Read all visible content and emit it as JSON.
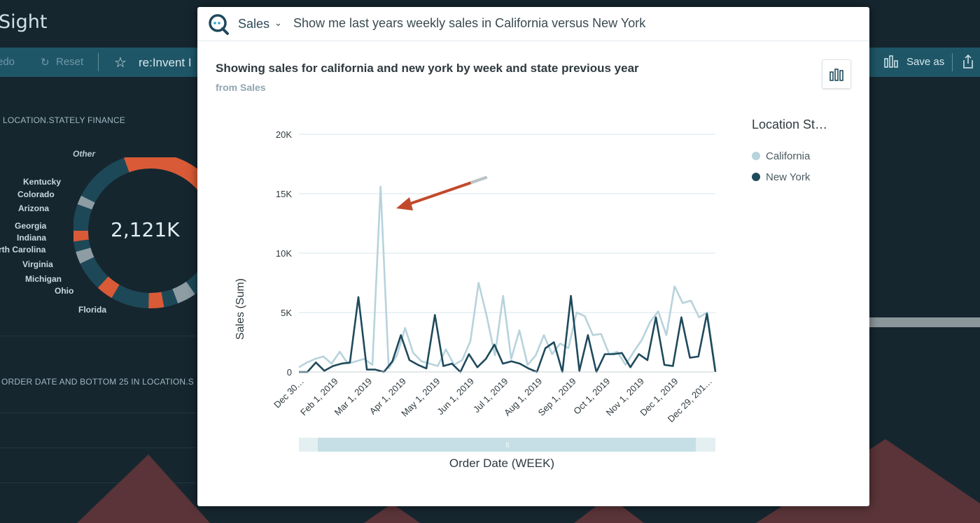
{
  "background": {
    "app_title": "Sight",
    "toolbar": {
      "redo": "edo",
      "reset": "Reset",
      "dashboard_name": "re:Invent I",
      "save_as": "Save as"
    },
    "section1_title": "LOCATION.STATELY FINANCE",
    "section2_title": "ORDER DATE AND BOTTOM 25 IN LOCATION.S",
    "donut_total": "2,121K",
    "donut_labels": [
      "Other",
      "Kentucky",
      "Colorado",
      "Arizona",
      "Georgia",
      "Indiana",
      "rth Carolina",
      "Virginia",
      "Michigan",
      "Ohio",
      "Florida"
    ]
  },
  "modal": {
    "dataset": "Sales",
    "query": "Show me last years weekly sales in California versus New York",
    "visual_title": "Showing sales for california and new york by week and state previous year",
    "visual_subtitle": "from Sales",
    "legend_title": "Location St…",
    "legend_items": [
      {
        "label": "California",
        "color": "#b7d3dc"
      },
      {
        "label": "New York",
        "color": "#1f4a5c"
      }
    ]
  },
  "chart_data": {
    "type": "line",
    "title": "Showing sales for california and new york by week and state previous year",
    "xlabel": "Order Date (WEEK)",
    "ylabel": "Sales (Sum)",
    "ylim": [
      0,
      20000
    ],
    "yticks": [
      "0",
      "5K",
      "10K",
      "15K",
      "20K"
    ],
    "xticks": [
      "Dec 30…",
      "Feb 1, 2019",
      "Mar 1, 2019",
      "Apr 1, 2019",
      "May 1, 2019",
      "Jun 1, 2019",
      "Jul 1, 2019",
      "Aug 1, 2019",
      "Sep 1, 2019",
      "Oct 1, 2019",
      "Nov 1, 2019",
      "Dec 1, 2019",
      "Dec 29, 201…"
    ],
    "grid": true,
    "legend_placement": "right",
    "series": [
      {
        "name": "California",
        "color": "#b7d3dc",
        "values": [
          400,
          800,
          1100,
          1300,
          700,
          1700,
          700,
          900,
          1100,
          600,
          15600,
          300,
          1400,
          3700,
          1600,
          900,
          700,
          500,
          1900,
          600,
          1000,
          2600,
          7500,
          4700,
          1400,
          6400,
          1100,
          3500,
          600,
          1400,
          3100,
          1500,
          2400,
          2000,
          5000,
          4700,
          3100,
          3200,
          1500,
          1700,
          600,
          1700,
          2700,
          4200,
          5100,
          3100,
          7200,
          5800,
          6000,
          4600,
          5000,
          200
        ]
      },
      {
        "name": "New York",
        "color": "#1f4a5c",
        "values": [
          0,
          0,
          800,
          100,
          500,
          700,
          800,
          6300,
          200,
          200,
          0,
          900,
          3100,
          1000,
          600,
          300,
          4800,
          500,
          700,
          0,
          1500,
          400,
          1100,
          2300,
          700,
          900,
          700,
          300,
          0,
          2000,
          2500,
          0,
          6400,
          100,
          3100,
          0,
          1500,
          1500,
          1600,
          400,
          1500,
          1000,
          4600,
          600,
          500,
          4600,
          1200,
          1300,
          4900,
          0
        ]
      }
    ]
  }
}
